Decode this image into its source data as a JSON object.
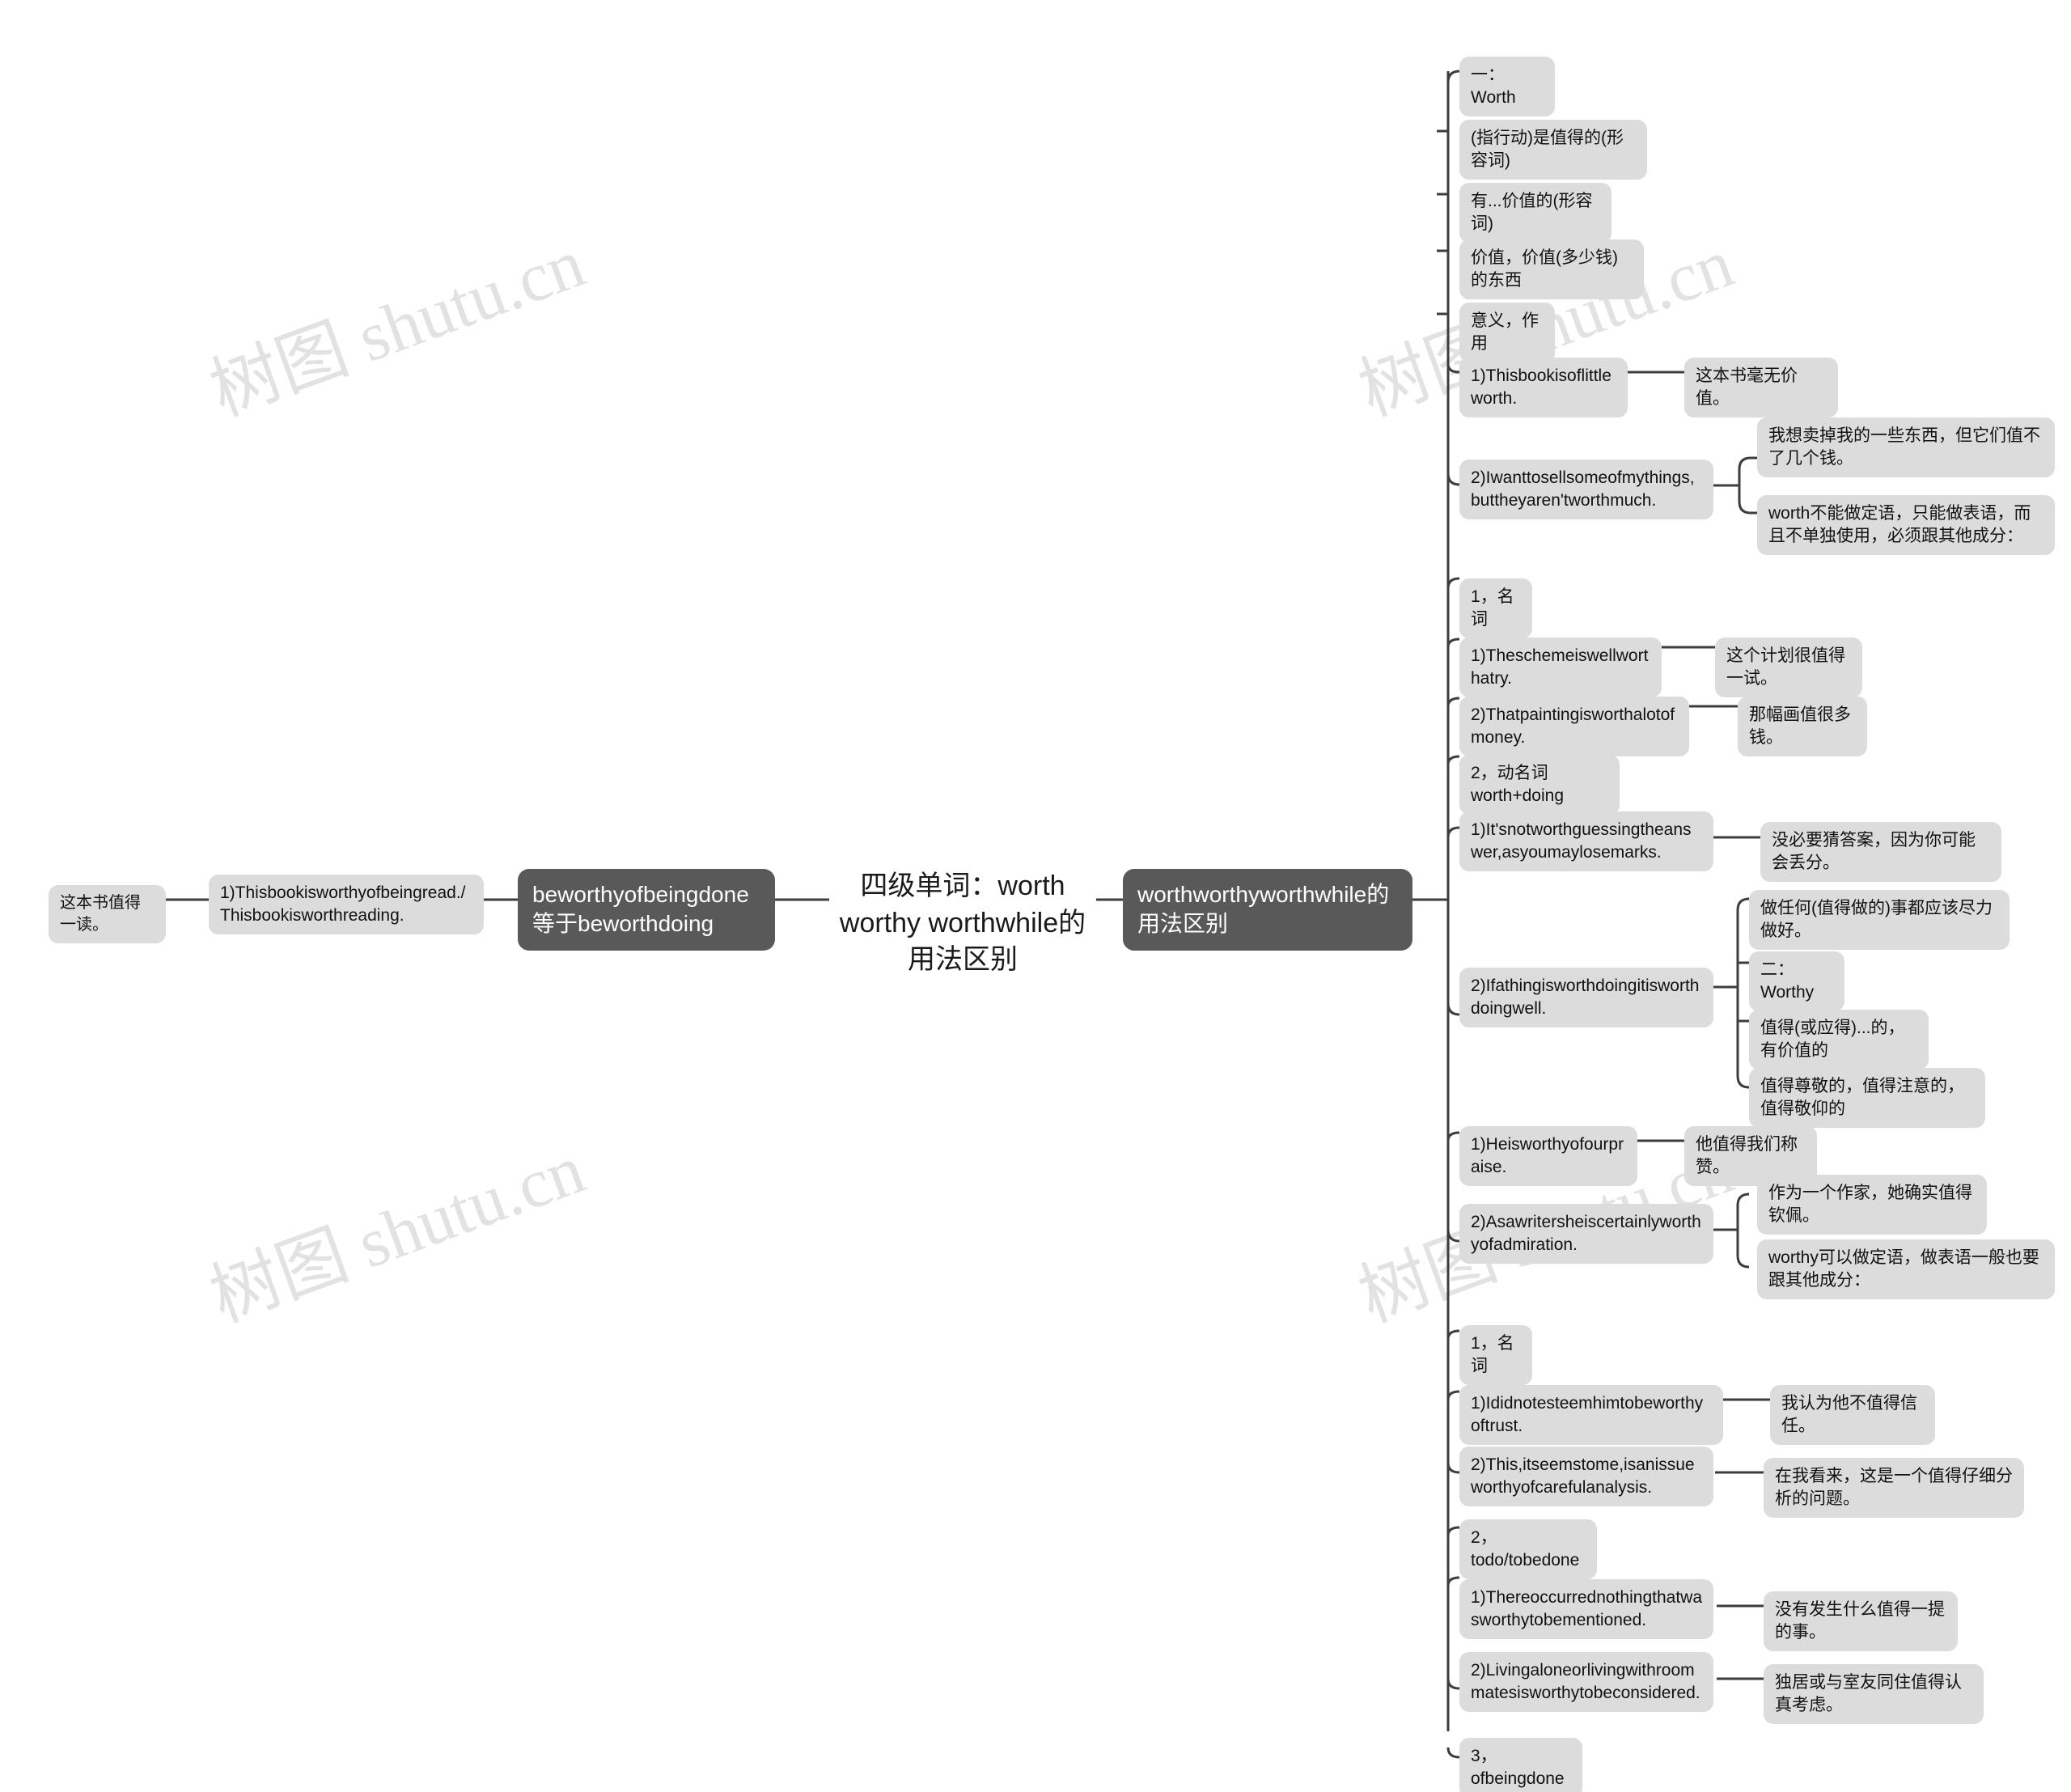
{
  "meta": {
    "watermark_text": "树图 shutu.cn",
    "colors": {
      "page_background": "#ffffff",
      "node_background": "#dcdcdc",
      "node_text": "#111111",
      "dark_node_background": "#595959",
      "dark_node_text": "#ffffff",
      "connector": "#3d3d3d",
      "watermark": "#e2e2e2"
    }
  },
  "root": {
    "title": "四级单词：worth worthy worthwhile的用法区别"
  },
  "left_branch": {
    "topic": "beworthyofbeingdone等于beworthdoing",
    "example": "1)Thisbookisworthyofbeingread./Thisbookisworthreading.",
    "translation": "这本书值得一读。"
  },
  "right_branch": {
    "topic": "worthworthyworthwhile的用法区别",
    "items": [
      {
        "id": "n1",
        "label": "一：Worth"
      },
      {
        "id": "n2",
        "label": "(指行动)是值得的(形容词)"
      },
      {
        "id": "n3",
        "label": "有...价值的(形容词)"
      },
      {
        "id": "n4",
        "label": "价值，价值(多少钱)的东西"
      },
      {
        "id": "n5",
        "label": "意义，作用"
      },
      {
        "id": "n6",
        "label": "1)Thisbookisoflittleworth.",
        "translation": "这本书毫无价值。"
      },
      {
        "id": "n7",
        "label": "2)Iwanttosellsomeofmythings,buttheyaren'tworthmuch.",
        "children": [
          "我想卖掉我的一些东西，但它们值不了几个钱。",
          "worth不能做定语，只能做表语，而且不单独使用，必须跟其他成分："
        ]
      },
      {
        "id": "n8",
        "label": "1，名词"
      },
      {
        "id": "n9",
        "label": "1)Theschemeiswellworthatry.",
        "translation": "这个计划很值得一试。"
      },
      {
        "id": "n10",
        "label": "2)Thatpaintingisworthalotofmoney.",
        "translation": "那幅画值很多钱。"
      },
      {
        "id": "n11",
        "label": "2，动名词worth+doing"
      },
      {
        "id": "n12",
        "label": "1)It'snotworthguessingtheanswer,asyoumaylosemarks.",
        "translation": "没必要猜答案，因为你可能会丢分。"
      },
      {
        "id": "n13",
        "label": "2)Ifathingisworthdoingitisworthdoingwell.",
        "children": [
          "做任何(值得做的)事都应该尽力做好。",
          "二：Worthy",
          "值得(或应得)...的，有价值的",
          "值得尊敬的，值得注意的，值得敬仰的"
        ]
      },
      {
        "id": "n14",
        "label": "1)Heisworthyofourpraise.",
        "translation": "他值得我们称赞。"
      },
      {
        "id": "n15",
        "label": "2)Asawritersheiscertainlyworthyofadmiration.",
        "children": [
          "作为一个作家，她确实值得钦佩。",
          "worthy可以做定语，做表语一般也要跟其他成分："
        ]
      },
      {
        "id": "n16",
        "label": "1，名词"
      },
      {
        "id": "n17",
        "label": "1)Ididnotesteemhimtobeworthyoftrust.",
        "translation": "我认为他不值得信任。"
      },
      {
        "id": "n18",
        "label": "2)This,itseemstome,isanissueworthyofcarefulanalysis.",
        "translation": "在我看来，这是一个值得仔细分析的问题。"
      },
      {
        "id": "n19",
        "label": "2，todo/tobedone"
      },
      {
        "id": "n20",
        "label": "1)Thereoccurrednothingthatwasworthytobementioned.",
        "translation": "没有发生什么值得一提的事。"
      },
      {
        "id": "n21",
        "label": "2)Livingaloneorlivingwithroommatesisworthytobeconsidered.",
        "translation": "独居或与室友同住值得认真考虑。"
      },
      {
        "id": "n22",
        "label": "3，ofbeingdone"
      }
    ]
  }
}
